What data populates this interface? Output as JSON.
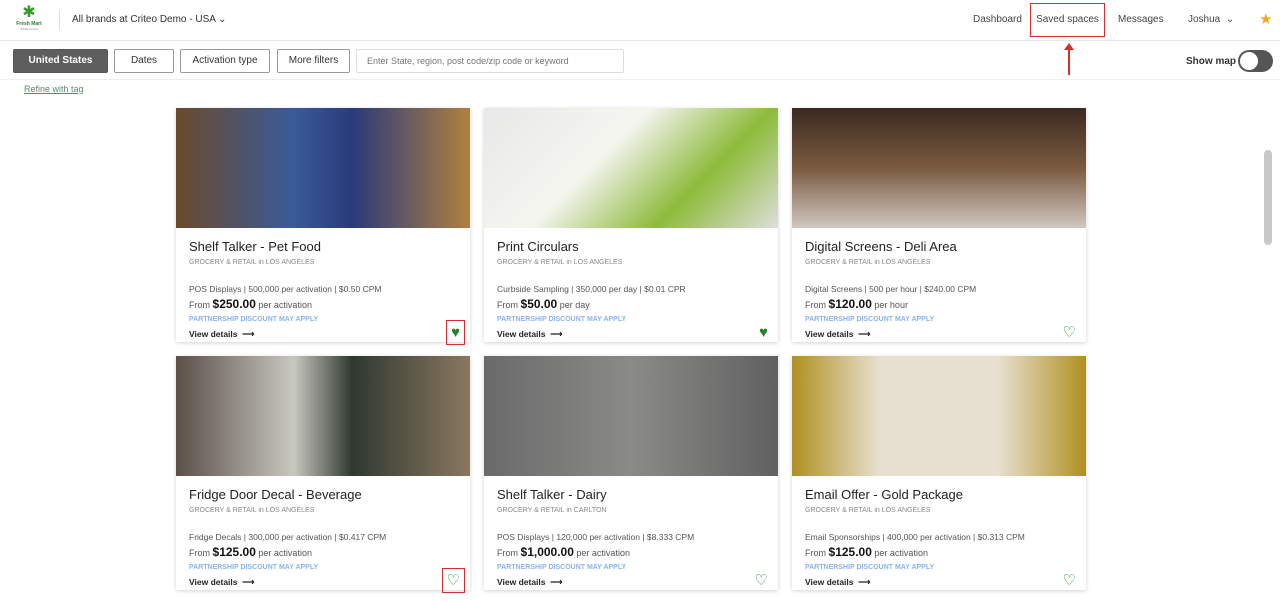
{
  "header": {
    "logo_text": "Fresh Mart",
    "logo_sub": "Whole Foods",
    "brand_selector": "All brands at Criteo Demo - USA",
    "nav": [
      "Dashboard",
      "Saved spaces",
      "Messages",
      "Joshua"
    ]
  },
  "filters": {
    "country": "United States",
    "dates": "Dates",
    "activation": "Activation type",
    "more": "More filters",
    "search_placeholder": "Enter State, region, post code/zip code or keyword",
    "show_map": "Show map",
    "refine": "Refine with tag"
  },
  "cards": [
    {
      "title": "Shelf Talker - Pet Food",
      "category": "GROCERY & RETAIL in LOS ANGELES",
      "stats": "POS Displays | 500,000 per activation | $0.50 CPM",
      "from": "From",
      "price": "$250.00",
      "unit": "per activation",
      "discount": "PARTNERSHIP DISCOUNT MAY APPLY",
      "view": "View details",
      "saved": true
    },
    {
      "title": "Print Circulars",
      "category": "GROCERY & RETAIL in LOS ANGELES",
      "stats": "Curbside Sampling | 350,000 per day | $0.01 CPR",
      "from": "From",
      "price": "$50.00",
      "unit": "per day",
      "discount": "PARTNERSHIP DISCOUNT MAY APPLY",
      "view": "View details",
      "saved": true
    },
    {
      "title": "Digital Screens - Deli Area",
      "category": "GROCERY & RETAIL in LOS ANGELES",
      "stats": "Digital Screens | 500 per hour | $240.00 CPM",
      "from": "From",
      "price": "$120.00",
      "unit": "per hour",
      "discount": "PARTNERSHIP DISCOUNT MAY APPLY",
      "view": "View details",
      "saved": false
    },
    {
      "title": "Fridge Door Decal - Beverage",
      "category": "GROCERY & RETAIL in LOS ANGELES",
      "stats": "Fridge Decals | 300,000 per activation | $0.417 CPM",
      "from": "From",
      "price": "$125.00",
      "unit": "per activation",
      "discount": "PARTNERSHIP DISCOUNT MAY APPLY",
      "view": "View details",
      "saved": false
    },
    {
      "title": "Shelf Talker - Dairy",
      "category": "GROCERY & RETAIL in CARLTON",
      "stats": "POS Displays | 120,000 per activation | $8.333 CPM",
      "from": "From",
      "price": "$1,000.00",
      "unit": "per activation",
      "discount": "PARTNERSHIP DISCOUNT MAY APPLY",
      "view": "View details",
      "saved": false
    },
    {
      "title": "Email Offer - Gold Package",
      "category": "GROCERY & RETAIL in LOS ANGELES",
      "stats": "Email Sponsorships | 400,000 per activation | $0.313 CPM",
      "from": "From",
      "price": "$125.00",
      "unit": "per activation",
      "discount": "PARTNERSHIP DISCOUNT MAY APPLY",
      "view": "View details",
      "saved": false
    }
  ]
}
